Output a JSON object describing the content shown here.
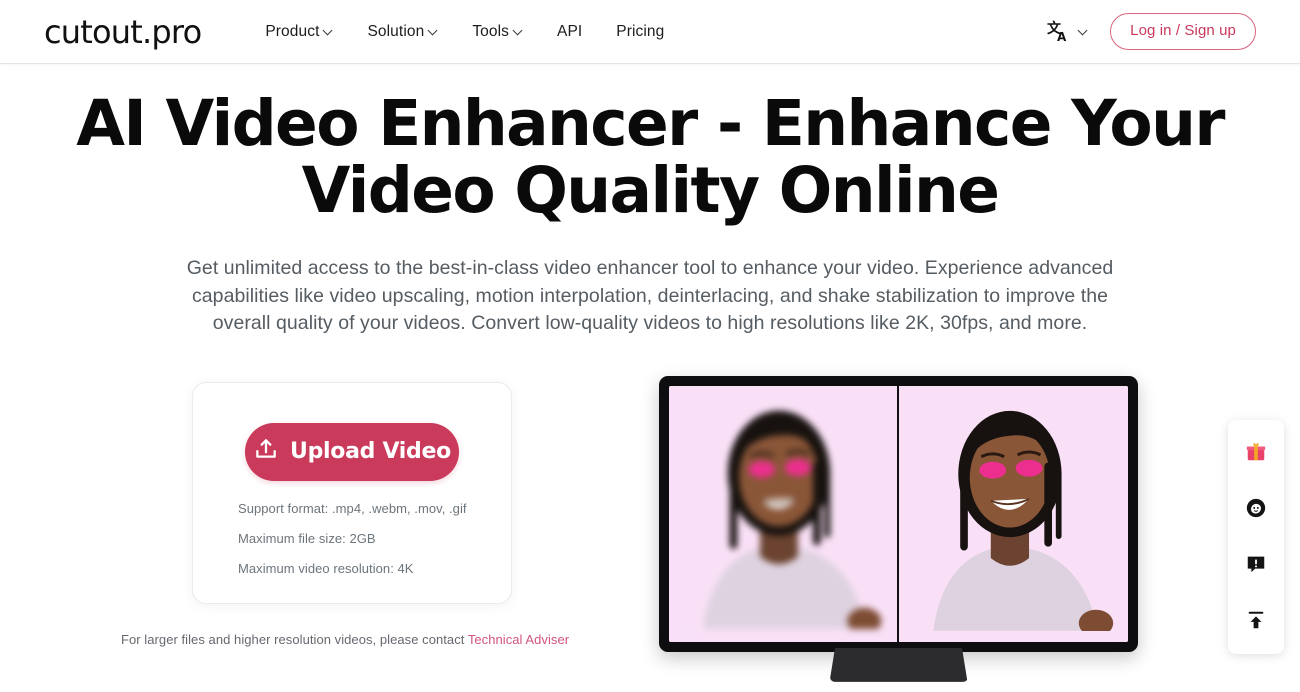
{
  "header": {
    "logo": "cutout.pro",
    "nav": [
      {
        "label": "Product",
        "has_caret": true
      },
      {
        "label": "Solution",
        "has_caret": true
      },
      {
        "label": "Tools",
        "has_caret": true
      },
      {
        "label": "API",
        "has_caret": false
      },
      {
        "label": "Pricing",
        "has_caret": false
      }
    ],
    "language_icon": "translate-icon",
    "login_label": "Log in / Sign up"
  },
  "hero": {
    "title": "AI Video Enhancer - Enhance Your Video Quality Online",
    "subtitle": "Get unlimited access to the best-in-class video enhancer tool to enhance your video. Experience advanced capabilities like video upscaling, motion interpolation, deinterlacing, and shake stabilization to improve the overall quality of your videos. Convert low-quality videos to high resolutions like 2K, 30fps, and more."
  },
  "upload": {
    "button_label": "Upload Video",
    "button_icon": "upload-icon",
    "specs": [
      "Support format: .mp4, .webm, .mov, .gif",
      "Maximum file size: 2GB",
      "Maximum video resolution: 4K"
    ],
    "contact_prefix": "For larger files and higher resolution videos, please contact ",
    "contact_link": "Technical Adviser"
  },
  "preview": {
    "alt_left": "Blurry low quality video frame of smiling woman with pink eyeshadow",
    "alt_right": "Enhanced sharp video frame of smiling woman with pink eyeshadow"
  },
  "float_bar": [
    {
      "icon": "gift-icon"
    },
    {
      "icon": "avatar-face-icon"
    },
    {
      "icon": "feedback-bubble-icon"
    },
    {
      "icon": "scroll-to-top-icon"
    }
  ],
  "colors": {
    "accent": "#c93a5b",
    "link": "#d1557a",
    "heading": "#0a0a0a",
    "body_text": "#555c62",
    "preview_bg": "#f8ddf5"
  }
}
